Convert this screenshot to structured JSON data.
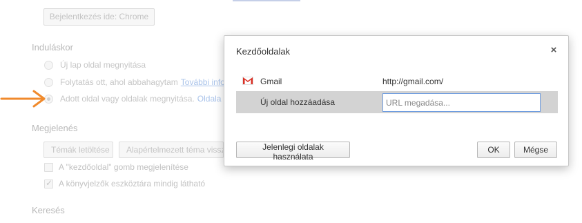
{
  "settings": {
    "signin_button": "Bejelentkezés ide: Chrome",
    "startup": {
      "title": "Induláskor",
      "options": [
        {
          "label": "Új lap oldal megnyitása"
        },
        {
          "label": "Folytatás ott, ahol abbahagytam",
          "link": "További info"
        },
        {
          "label": "Adott oldal vagy oldalak megnyitása.",
          "link": "Oldala"
        }
      ]
    },
    "appearance": {
      "title": "Megjelenés",
      "themes_button": "Témák letöltése",
      "reset_theme_button": "Alapértelmezett téma vissz",
      "checkboxes": [
        {
          "label": "A \"kezdőoldal\" gomb megjelenítése",
          "checked": false
        },
        {
          "label": "A könyvjelzők eszköztára mindig látható",
          "checked": true
        }
      ]
    },
    "search": {
      "title": "Keresés"
    }
  },
  "dialog": {
    "title": "Kezdőoldalak",
    "close_glyph": "×",
    "pages": [
      {
        "name": "Gmail",
        "url": "http://gmail.com/",
        "icon": "gmail-icon"
      }
    ],
    "add_row": {
      "label": "Új oldal hozzáadása",
      "input_placeholder": "URL megadása...",
      "input_value": ""
    },
    "use_current_button": "Jelenlegi oldalak használata",
    "ok_button": "OK",
    "cancel_button": "Mégse"
  },
  "colors": {
    "annotation_arrow": "#f08a2c",
    "input_focus_border": "#6f9de0",
    "selected_row": "#d3d3d3",
    "gmail_red": "#d93025"
  }
}
